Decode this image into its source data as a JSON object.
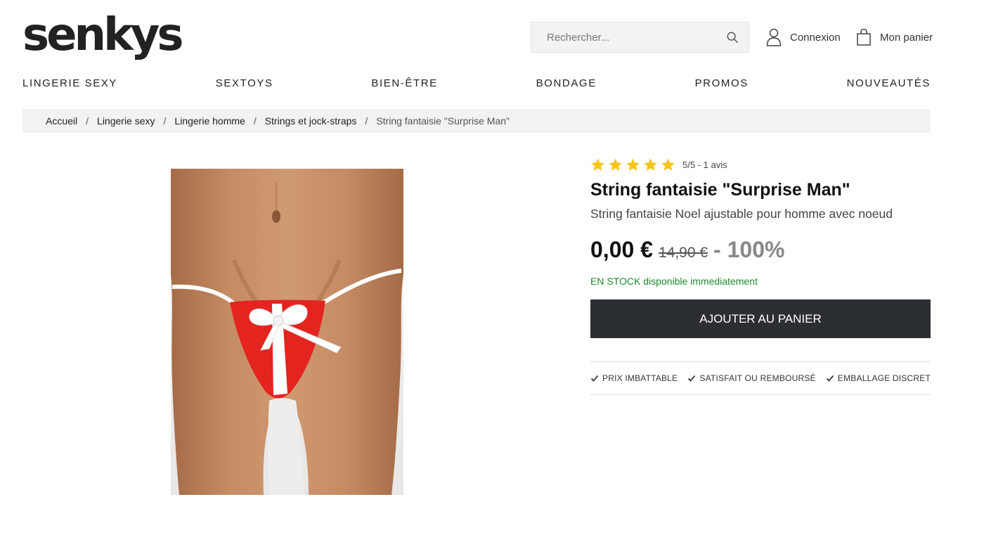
{
  "brand": {
    "logo_text": "senkys"
  },
  "header": {
    "search_placeholder": "Rechercher...",
    "account_label": "Connexion",
    "cart_label": "Mon panier"
  },
  "nav": {
    "items": [
      {
        "label": "LINGERIE SEXY"
      },
      {
        "label": "SEXTOYS"
      },
      {
        "label": "BIEN-ÊTRE"
      },
      {
        "label": "BONDAGE"
      },
      {
        "label": "PROMOS"
      },
      {
        "label": "NOUVEAUTÉS"
      }
    ]
  },
  "breadcrumb": {
    "items": [
      {
        "label": "Accueil"
      },
      {
        "label": "Lingerie sexy"
      },
      {
        "label": "Lingerie homme"
      },
      {
        "label": "Strings et jock-straps"
      },
      {
        "label": "String fantaisie \"Surprise Man\""
      }
    ],
    "separator": "/"
  },
  "product": {
    "rating_value": 5,
    "rating_max": 5,
    "rating_text": "5/5 - 1 avis",
    "title": "String fantaisie \"Surprise Man\"",
    "subtitle": "String fantaisie Noel ajustable pour homme avec noeud",
    "price": "0,00 €",
    "old_price": "14,90 €",
    "discount": "- 100%",
    "stock": "EN STOCK disponible immediatement",
    "add_to_cart": "AJOUTER AU PANIER",
    "guarantees": [
      {
        "label": "PRIX IMBATTABLE"
      },
      {
        "label": "SATISFAIT OU REMBOURSÉ"
      },
      {
        "label": "EMBALLAGE DISCRET"
      }
    ]
  },
  "colors": {
    "star": "#f5c518",
    "button_bg": "#2b2e33",
    "stock_green": "#1f8a2e",
    "product_red": "#e3241f"
  }
}
